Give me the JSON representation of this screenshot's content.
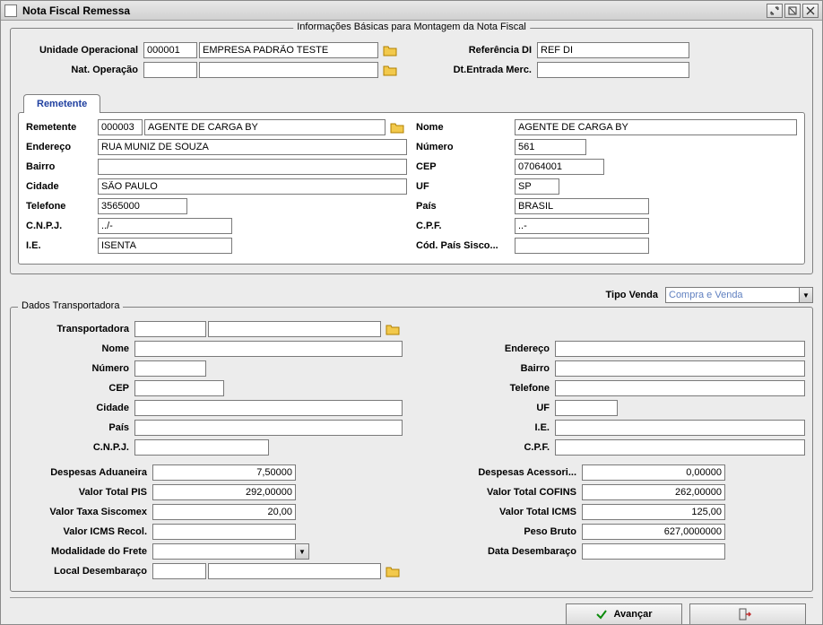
{
  "window": {
    "title": "Nota Fiscal Remessa"
  },
  "basic_info": {
    "group_title": "Informações Básicas para Montagem da Nota Fiscal",
    "unidade_op_label": "Unidade Operacional",
    "unidade_op_code": "000001",
    "unidade_op_desc": "EMPRESA PADRÃO TESTE",
    "nat_op_label": "Nat. Operação",
    "nat_op_value": "",
    "ref_di_label": "Referência DI",
    "ref_di_value": "REF DI",
    "dt_entrada_label": "Dt.Entrada Merc.",
    "dt_entrada_value": ""
  },
  "tab": {
    "remetente_label": "Remetente",
    "remetente_code_label": "Remetente",
    "remetente_code": "000003",
    "remetente_desc": "AGENTE DE CARGA BY",
    "endereco_label": "Endereço",
    "endereco_value": "RUA MUNIZ DE SOUZA",
    "bairro_label": "Bairro",
    "bairro_value": "",
    "cidade_label": "Cidade",
    "cidade_value": "SÃO PAULO",
    "telefone_label": "Telefone",
    "telefone_value": "3565000",
    "cnpj_label": "C.N.P.J.",
    "cnpj_value": "../-",
    "ie_label": "I.E.",
    "ie_value": "ISENTA",
    "nome_label": "Nome",
    "nome_value": "AGENTE DE CARGA BY",
    "numero_label": "Número",
    "numero_value": "561",
    "cep_label": "CEP",
    "cep_value": "07064001",
    "uf_label": "UF",
    "uf_value": "SP",
    "pais_label": "País",
    "pais_value": "BRASIL",
    "cpf_label": "C.P.F.",
    "cpf_value": "..-",
    "cod_pais_label": "Cód. País Sisco...",
    "cod_pais_value": ""
  },
  "tipo_venda": {
    "label": "Tipo Venda",
    "value": "Compra e Venda"
  },
  "transport": {
    "group_title": "Dados Transportadora",
    "transportadora_label": "Transportadora",
    "transportadora_code": "",
    "transportadora_desc": "",
    "nome_label": "Nome",
    "nome_value": "",
    "numero_label": "Número",
    "numero_value": "",
    "cep_label": "CEP",
    "cep_value": "",
    "cidade_label": "Cidade",
    "cidade_value": "",
    "pais_label": "País",
    "pais_value": "",
    "cnpj_label": "C.N.P.J.",
    "cnpj_value": "",
    "endereco_label": "Endereço",
    "endereco_value": "",
    "bairro_label": "Bairro",
    "bairro_value": "",
    "telefone_label": "Telefone",
    "telefone_value": "",
    "uf_label": "UF",
    "uf_value": "",
    "ie_label": "I.E.",
    "ie_value": "",
    "cpf_label": "C.P.F.",
    "cpf_value": ""
  },
  "totals": {
    "desp_aduaneira_label": "Despesas Aduaneira",
    "desp_aduaneira_value": "7,50000",
    "valor_pis_label": "Valor Total PIS",
    "valor_pis_value": "292,00000",
    "taxa_siscomex_label": "Valor Taxa Siscomex",
    "taxa_siscomex_value": "20,00",
    "icms_recol_label": "Valor ICMS Recol.",
    "icms_recol_value": "",
    "modalidade_frete_label": "Modalidade do Frete",
    "modalidade_frete_value": "",
    "local_desembaraco_label": "Local Desembaraço",
    "local_desembaraco_code": "",
    "local_desembaraco_desc": "",
    "desp_acessori_label": "Despesas Acessori...",
    "desp_acessori_value": "0,00000",
    "valor_cofins_label": "Valor Total COFINS",
    "valor_cofins_value": "262,00000",
    "valor_icms_label": "Valor Total ICMS",
    "valor_icms_value": "125,00",
    "peso_bruto_label": "Peso Bruto",
    "peso_bruto_value": "627,0000000",
    "data_desembaraco_label": "Data Desembaraço",
    "data_desembaraco_value": ""
  },
  "buttons": {
    "avancar": "Avançar",
    "sair": ""
  }
}
